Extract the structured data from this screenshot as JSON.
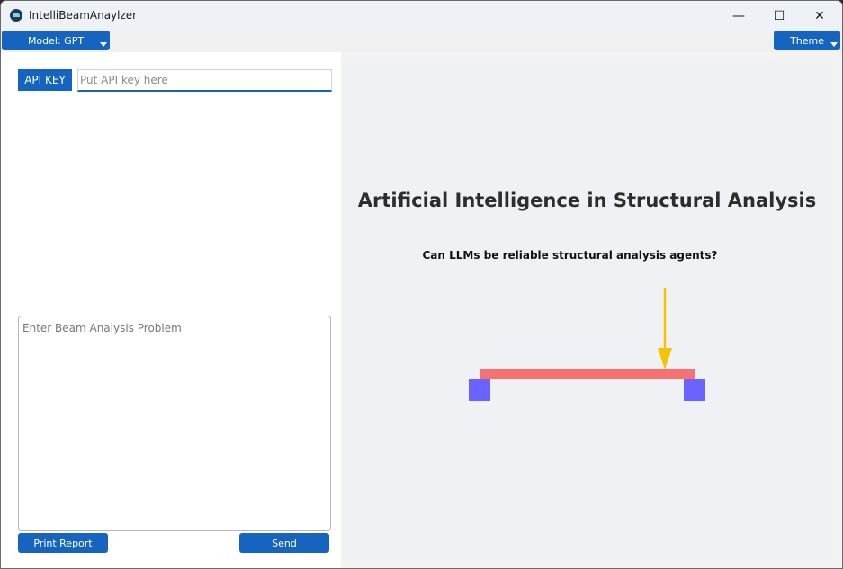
{
  "window": {
    "title": "IntelliBeamAnaylzer",
    "controls": {
      "minimize": "—",
      "maximize": "☐",
      "close": "✕"
    }
  },
  "menubar": {
    "model_label": "Model: GPT",
    "theme_label": "Theme"
  },
  "left": {
    "api_key_label": "API KEY",
    "api_key_value": "",
    "api_key_placeholder": "Put API key here",
    "problem_value": "",
    "problem_placeholder": "Enter Beam Analysis Problem",
    "print_report_label": "Print Report",
    "send_label": "Send"
  },
  "right": {
    "title": "Artificial Intelligence in Structural Analysis",
    "subtitle": "Can LLMs be reliable structural analysis agents?",
    "diagram": {
      "beam_color": "#f87171",
      "support_color": "#6b63ff",
      "load_color": "#f5c400"
    }
  },
  "colors": {
    "accent": "#1565c0",
    "right_background": "#f0f1f5"
  },
  "icons": {
    "app": "app-logo-icon",
    "dropdown": "caret-down-icon"
  }
}
